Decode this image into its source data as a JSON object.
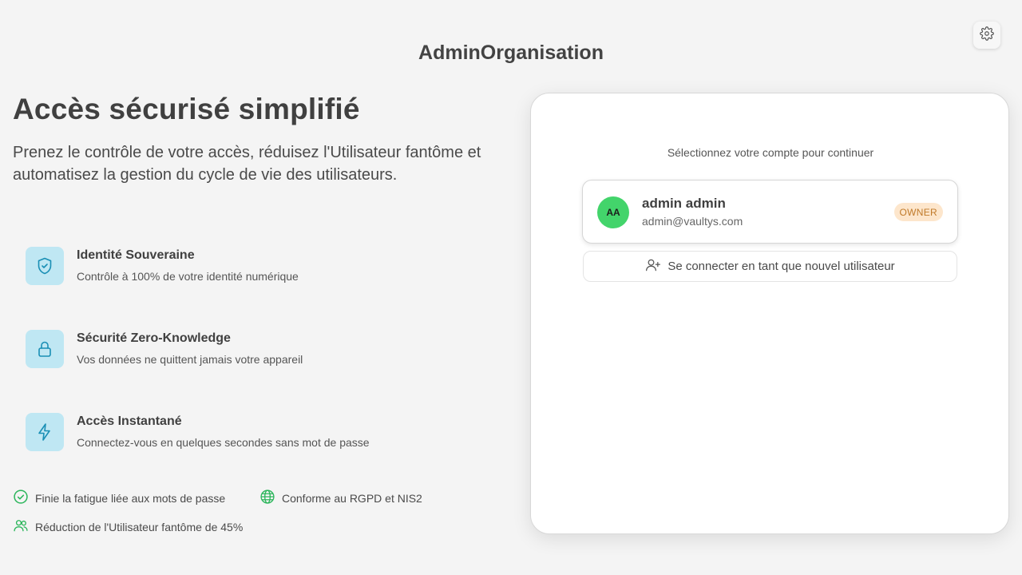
{
  "header": {
    "title": "AdminOrganisation",
    "settings_icon": "gear-icon"
  },
  "hero": {
    "title": "Accès sécurisé simplifié",
    "subtitle": "Prenez le contrôle de votre accès, réduisez l'Utilisateur fantôme et automatisez la gestion du cycle de vie des utilisateurs."
  },
  "features": [
    {
      "icon": "shield-check-icon",
      "title": "Identité Souveraine",
      "description": "Contrôle à 100% de votre identité numérique"
    },
    {
      "icon": "lock-icon",
      "title": "Sécurité Zero-Knowledge",
      "description": "Vos données ne quittent jamais votre appareil"
    },
    {
      "icon": "lightning-icon",
      "title": "Accès Instantané",
      "description": "Connectez-vous en quelques secondes sans mot de passe"
    }
  ],
  "badges": [
    {
      "icon": "check-circle-icon",
      "label": "Finie la fatigue liée aux mots de passe"
    },
    {
      "icon": "globe-icon",
      "label": "Conforme au RGPD et NIS2"
    },
    {
      "icon": "users-icon",
      "label": "Réduction de l'Utilisateur fantôme de 45%"
    }
  ],
  "login_card": {
    "prompt": "Sélectionnez votre compte pour continuer",
    "account": {
      "initials": "AA",
      "name": "admin admin",
      "email": "admin@vaultys.com",
      "role": "OWNER"
    },
    "new_user_label": "Se connecter en tant que nouvel utilisateur",
    "new_user_icon": "user-plus-icon"
  },
  "colors": {
    "background": "#f4f4f4",
    "feature_icon_bg": "#bfe7f3",
    "feature_icon_stroke": "#1a8fb5",
    "accent_green": "#2ab55a",
    "avatar_bg": "#43d46b",
    "owner_badge_bg": "#fde6cc",
    "owner_badge_text": "#c07a2a"
  }
}
